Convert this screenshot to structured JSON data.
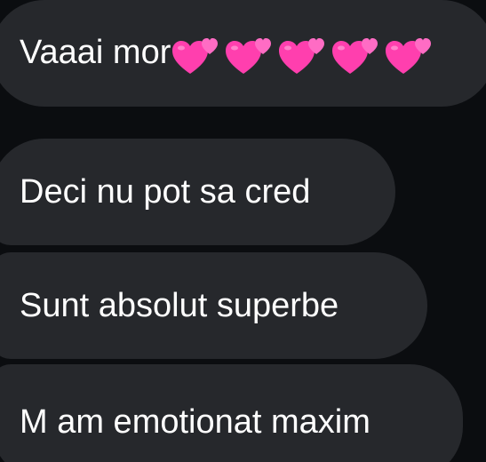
{
  "messages": [
    {
      "text": "Vaaai mor",
      "emoji": [
        "two-hearts",
        "two-hearts",
        "two-hearts",
        "two-hearts",
        "two-hearts"
      ]
    },
    {
      "text": "Deci nu pot sa cred"
    },
    {
      "text": "Sunt absolut superbe"
    },
    {
      "text": "M am emotionat maxim"
    }
  ],
  "colors": {
    "background": "#0b0d10",
    "bubble": "#26282c",
    "text": "#ffffff",
    "heart": "#ff3fae"
  }
}
